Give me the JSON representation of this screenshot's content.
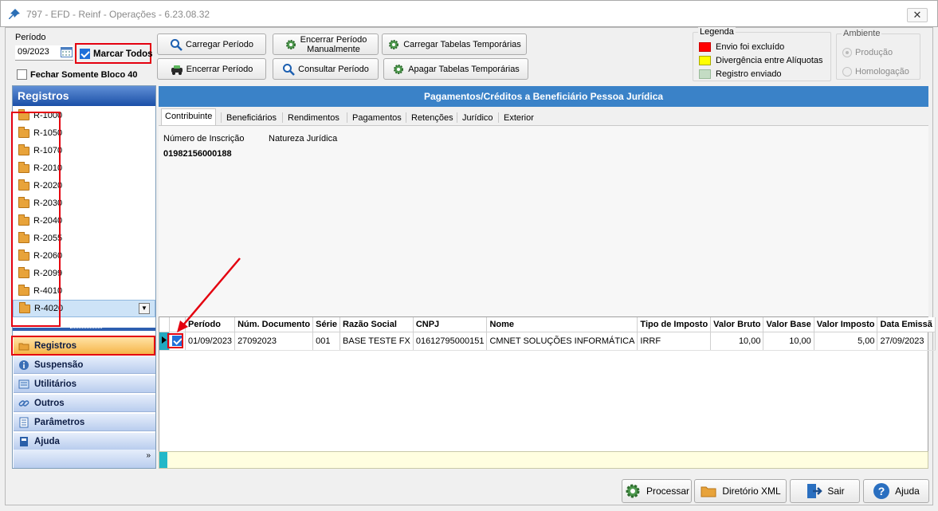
{
  "window": {
    "title": "797 - EFD - Reinf - Operações - 6.23.08.32",
    "close_glyph": "✕"
  },
  "top": {
    "periodo_label": "Período",
    "periodo_value": "09/2023",
    "marcar_todos": "Marcar Todos",
    "marcar_todos_checked": true,
    "fechar_bloco40": "Fechar Somente Bloco 40",
    "fechar_bloco40_checked": false,
    "buttons": {
      "carregar_periodo": "Carregar Período",
      "encerrar_periodo": "Encerrar Período",
      "encerrar_manual_1": "Encerrar Período",
      "encerrar_manual_2": "Manualmente",
      "consultar_periodo": "Consultar Período",
      "carregar_tabelas": "Carregar Tabelas Temporárias",
      "apagar_tabelas": "Apagar Tabelas Temporárias"
    }
  },
  "legend": {
    "title": "Legenda",
    "items": [
      {
        "label": "Envio foi excluído",
        "color": "#ff0000"
      },
      {
        "label": "Divergência entre Alíquotas",
        "color": "#ffff00"
      },
      {
        "label": "Registro enviado",
        "color": "#c4dcc4"
      }
    ]
  },
  "ambiente": {
    "title": "Ambiente",
    "options": [
      "Produção",
      "Homologação"
    ],
    "selected": "Produção"
  },
  "left": {
    "header": "Registros",
    "registros": [
      "R-1000",
      "R-1050",
      "R-1070",
      "R-2010",
      "R-2020",
      "R-2030",
      "R-2040",
      "R-2055",
      "R-2060",
      "R-2099",
      "R-4010",
      "R-4020"
    ],
    "selected": "R-4020",
    "nav": [
      {
        "label": "Registros",
        "icon": "folder-icon",
        "active": true
      },
      {
        "label": "Suspensão",
        "icon": "info-icon"
      },
      {
        "label": "Utilitários",
        "icon": "tools-icon"
      },
      {
        "label": "Outros",
        "icon": "link-icon"
      },
      {
        "label": "Parâmetros",
        "icon": "parameters-icon"
      },
      {
        "label": "Ajuda",
        "icon": "help-book-icon"
      }
    ]
  },
  "main": {
    "header": "Pagamentos/Créditos a Beneficiário Pessoa Jurídica",
    "tabs": [
      "Contribuinte",
      "Beneficiários",
      "Rendimentos",
      "Pagamentos",
      "Retenções",
      "Jurídico",
      "Exterior"
    ],
    "active_tab": "Contribuinte",
    "contribuinte": {
      "num_inscricao_label": "Número de Inscrição",
      "natureza_label": "Natureza Jurídica",
      "num_inscricao_value": "01982156000188"
    },
    "grid": {
      "columns": [
        "Período",
        "Núm. Documento",
        "Série",
        "Razão Social",
        "CNPJ",
        "Nome",
        "Tipo de Imposto",
        "Valor Bruto",
        "Valor Base",
        "Valor Imposto",
        "Data Emissã"
      ],
      "rows": [
        {
          "checked": true,
          "cells": [
            "01/09/2023",
            "27092023",
            "001",
            "BASE TESTE FX",
            "01612795000151",
            "CMNET SOLUÇÕES INFORMÁTICA",
            "IRRF",
            "10,00",
            "10,00",
            "5,00",
            "27/09/2023"
          ]
        }
      ]
    }
  },
  "bottom": {
    "processar": "Processar",
    "diretorio_xml": "Diretório XML",
    "sair": "Sair",
    "ajuda": "Ajuda"
  },
  "colors": {
    "accent_blue": "#3a82c8",
    "annotation_red": "#e4000f",
    "nav_active": "#f6b54a"
  }
}
